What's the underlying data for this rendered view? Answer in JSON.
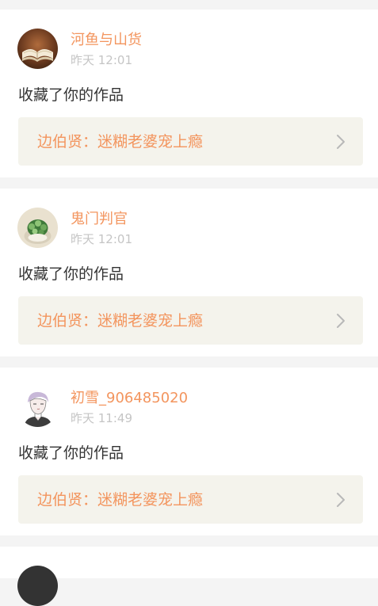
{
  "feed": {
    "items": [
      {
        "username": "河鱼与山货",
        "time": "昨天 12:01",
        "action": "收藏了你的作品",
        "work": "边伯贤：迷糊老婆宠上瘾",
        "avatar": "book-icon"
      },
      {
        "username": "鬼门判官",
        "time": "昨天 12:01",
        "action": "收藏了你的作品",
        "work": "边伯贤：迷糊老婆宠上瘾",
        "avatar": "plant-icon"
      },
      {
        "username": "初雪_906485020",
        "time": "昨天 11:49",
        "action": "收藏了你的作品",
        "work": "边伯贤：迷糊老婆宠上瘾",
        "avatar": "person-icon"
      }
    ]
  },
  "colors": {
    "accent": "#f3955e",
    "time": "#c5c5c5",
    "text": "#333333",
    "link_bg": "#f4f3ec",
    "page_bg": "#f4f4f4"
  }
}
